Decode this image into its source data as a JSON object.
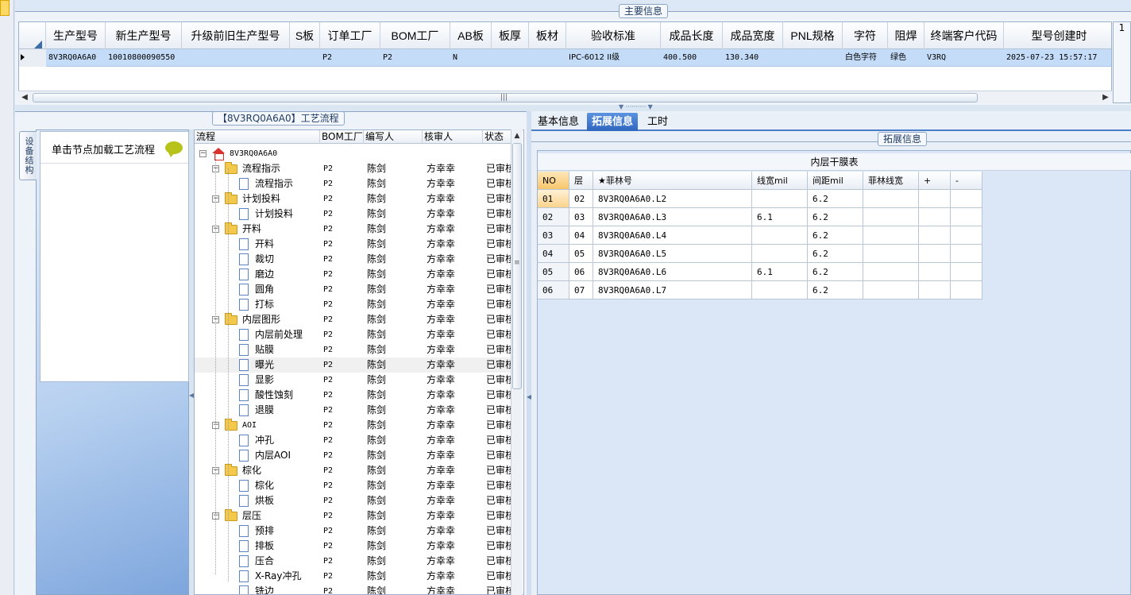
{
  "top": {
    "frame_title": "主要信息",
    "columns": [
      "生产型号",
      "新生产型号",
      "升级前旧生产型号",
      "S板",
      "订单工厂",
      "BOM工厂",
      "AB板",
      "板厚",
      "板材",
      "验收标准",
      "成品长度",
      "成品宽度",
      "PNL规格",
      "字符",
      "阻焊",
      "终端客户代码",
      "型号创建时"
    ],
    "row": [
      "8V3RQ0A6A0",
      "10010800090550",
      "",
      "",
      "P2",
      "P2",
      "N",
      "",
      "",
      "IPC-6012 II级",
      "400.500",
      "130.340",
      "",
      "白色字符",
      "绿色",
      "V3RQ",
      "2025-07-23 15:57:17"
    ],
    "right_button": "1"
  },
  "left": {
    "side_tab": "设备结构",
    "card_text": "单击节点加载工艺流程",
    "frame_title": "【8V3RQ0A6A0】工艺流程"
  },
  "tree": {
    "columns": [
      "流程",
      "BOM工厂",
      "编写人",
      "核审人",
      "状态"
    ],
    "rows": [
      {
        "name": "8V3RQ0A6A0",
        "level": 0,
        "kind": "root",
        "bom": "",
        "writer": "",
        "reviewer": "",
        "status": ""
      },
      {
        "name": "流程指示",
        "level": 1,
        "kind": "folder",
        "bom": "P2",
        "writer": "陈剑",
        "reviewer": "方幸幸",
        "status": "已审核"
      },
      {
        "name": "流程指示",
        "level": 2,
        "kind": "doc",
        "bom": "P2",
        "writer": "陈剑",
        "reviewer": "方幸幸",
        "status": "已审核"
      },
      {
        "name": "计划投料",
        "level": 1,
        "kind": "folder",
        "bom": "P2",
        "writer": "陈剑",
        "reviewer": "方幸幸",
        "status": "已审核"
      },
      {
        "name": "计划投料",
        "level": 2,
        "kind": "doc",
        "bom": "P2",
        "writer": "陈剑",
        "reviewer": "方幸幸",
        "status": "已审核"
      },
      {
        "name": "开料",
        "level": 1,
        "kind": "folder",
        "bom": "P2",
        "writer": "陈剑",
        "reviewer": "方幸幸",
        "status": "已审核"
      },
      {
        "name": "开料",
        "level": 2,
        "kind": "doc",
        "bom": "P2",
        "writer": "陈剑",
        "reviewer": "方幸幸",
        "status": "已审核"
      },
      {
        "name": "裁切",
        "level": 2,
        "kind": "doc",
        "bom": "P2",
        "writer": "陈剑",
        "reviewer": "方幸幸",
        "status": "已审核"
      },
      {
        "name": "磨边",
        "level": 2,
        "kind": "doc",
        "bom": "P2",
        "writer": "陈剑",
        "reviewer": "方幸幸",
        "status": "已审核"
      },
      {
        "name": "圆角",
        "level": 2,
        "kind": "doc",
        "bom": "P2",
        "writer": "陈剑",
        "reviewer": "方幸幸",
        "status": "已审核"
      },
      {
        "name": "打标",
        "level": 2,
        "kind": "doc",
        "bom": "P2",
        "writer": "陈剑",
        "reviewer": "方幸幸",
        "status": "已审核"
      },
      {
        "name": "内层图形",
        "level": 1,
        "kind": "folder",
        "bom": "P2",
        "writer": "陈剑",
        "reviewer": "方幸幸",
        "status": "已审核"
      },
      {
        "name": "内层前处理",
        "level": 2,
        "kind": "doc",
        "bom": "P2",
        "writer": "陈剑",
        "reviewer": "方幸幸",
        "status": "已审核"
      },
      {
        "name": "贴膜",
        "level": 2,
        "kind": "doc",
        "bom": "P2",
        "writer": "陈剑",
        "reviewer": "方幸幸",
        "status": "已审核"
      },
      {
        "name": "曝光",
        "level": 2,
        "kind": "doc",
        "bom": "P2",
        "writer": "陈剑",
        "reviewer": "方幸幸",
        "status": "已审核",
        "highlight": true
      },
      {
        "name": "显影",
        "level": 2,
        "kind": "doc",
        "bom": "P2",
        "writer": "陈剑",
        "reviewer": "方幸幸",
        "status": "已审核"
      },
      {
        "name": "酸性蚀刻",
        "level": 2,
        "kind": "doc",
        "bom": "P2",
        "writer": "陈剑",
        "reviewer": "方幸幸",
        "status": "已审核"
      },
      {
        "name": "退膜",
        "level": 2,
        "kind": "doc",
        "bom": "P2",
        "writer": "陈剑",
        "reviewer": "方幸幸",
        "status": "已审核"
      },
      {
        "name": "AOI",
        "level": 1,
        "kind": "folder",
        "bom": "P2",
        "writer": "陈剑",
        "reviewer": "方幸幸",
        "status": "已审核"
      },
      {
        "name": "冲孔",
        "level": 2,
        "kind": "doc",
        "bom": "P2",
        "writer": "陈剑",
        "reviewer": "方幸幸",
        "status": "已审核"
      },
      {
        "name": "内层AOI",
        "level": 2,
        "kind": "doc",
        "bom": "P2",
        "writer": "陈剑",
        "reviewer": "方幸幸",
        "status": "已审核"
      },
      {
        "name": "棕化",
        "level": 1,
        "kind": "folder",
        "bom": "P2",
        "writer": "陈剑",
        "reviewer": "方幸幸",
        "status": "已审核"
      },
      {
        "name": "棕化",
        "level": 2,
        "kind": "doc",
        "bom": "P2",
        "writer": "陈剑",
        "reviewer": "方幸幸",
        "status": "已审核"
      },
      {
        "name": "烘板",
        "level": 2,
        "kind": "doc",
        "bom": "P2",
        "writer": "陈剑",
        "reviewer": "方幸幸",
        "status": "已审核"
      },
      {
        "name": "层压",
        "level": 1,
        "kind": "folder",
        "bom": "P2",
        "writer": "陈剑",
        "reviewer": "方幸幸",
        "status": "已审核"
      },
      {
        "name": "预排",
        "level": 2,
        "kind": "doc",
        "bom": "P2",
        "writer": "陈剑",
        "reviewer": "方幸幸",
        "status": "已审核"
      },
      {
        "name": "排板",
        "level": 2,
        "kind": "doc",
        "bom": "P2",
        "writer": "陈剑",
        "reviewer": "方幸幸",
        "status": "已审核"
      },
      {
        "name": "压合",
        "level": 2,
        "kind": "doc",
        "bom": "P2",
        "writer": "陈剑",
        "reviewer": "方幸幸",
        "status": "已审核"
      },
      {
        "name": "X-Ray冲孔",
        "level": 2,
        "kind": "doc",
        "bom": "P2",
        "writer": "陈剑",
        "reviewer": "方幸幸",
        "status": "已审核"
      },
      {
        "name": "铣边",
        "level": 2,
        "kind": "doc",
        "bom": "P2",
        "writer": "陈剑",
        "reviewer": "方幸幸",
        "status": "已审核"
      }
    ]
  },
  "right": {
    "tabs": [
      "基本信息",
      "拓展信息",
      "工时"
    ],
    "active_tab": 1,
    "frame_title": "拓展信息",
    "table_title": "内层干膜表",
    "columns": [
      "NO",
      "层",
      "★菲林号",
      "线宽mil",
      "间距mil",
      "菲林线宽",
      "+",
      "-"
    ],
    "rows": [
      [
        "01",
        "02",
        "8V3RQ0A6A0.L2",
        "",
        "6.2",
        "",
        "",
        ""
      ],
      [
        "02",
        "03",
        "8V3RQ0A6A0.L3",
        "6.1",
        "6.2",
        "",
        "",
        ""
      ],
      [
        "03",
        "04",
        "8V3RQ0A6A0.L4",
        "",
        "6.2",
        "",
        "",
        ""
      ],
      [
        "04",
        "05",
        "8V3RQ0A6A0.L5",
        "",
        "6.2",
        "",
        "",
        ""
      ],
      [
        "05",
        "06",
        "8V3RQ0A6A0.L6",
        "6.1",
        "6.2",
        "",
        "",
        ""
      ],
      [
        "06",
        "07",
        "8V3RQ0A6A0.L7",
        "",
        "6.2",
        "",
        "",
        ""
      ]
    ]
  },
  "icons": [
    "home-icon",
    "folder-icon",
    "doc-icon",
    "chat-icon",
    "expand-icon",
    "collapse-icon"
  ]
}
